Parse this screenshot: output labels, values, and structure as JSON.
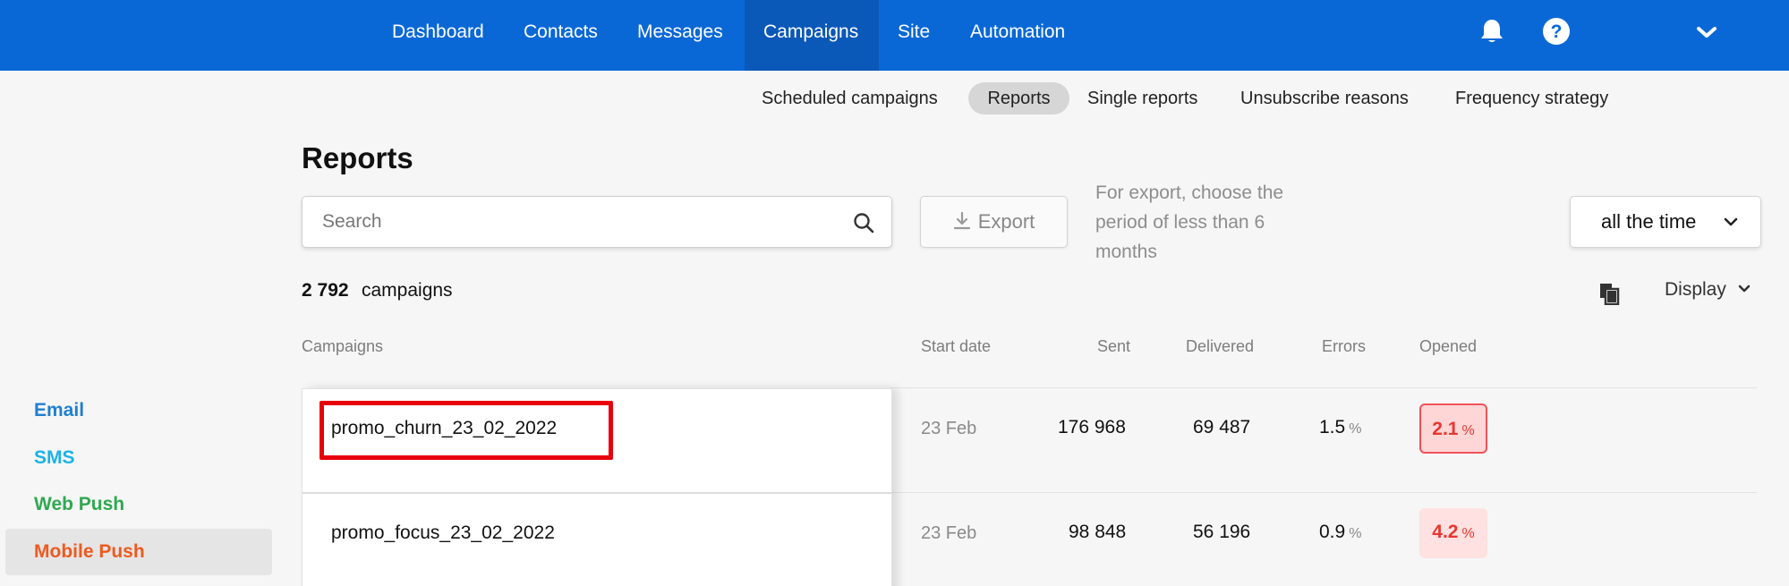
{
  "nav": {
    "items": [
      {
        "label": "Dashboard"
      },
      {
        "label": "Contacts"
      },
      {
        "label": "Messages"
      },
      {
        "label": "Campaigns",
        "active": true
      },
      {
        "label": "Site"
      },
      {
        "label": "Automation"
      }
    ],
    "icons": [
      "bell-icon",
      "help-icon",
      "chevron-down-icon"
    ]
  },
  "subnav": {
    "items": [
      {
        "label": "Scheduled campaigns"
      },
      {
        "label": "Reports",
        "active": true
      },
      {
        "label": "Single reports"
      },
      {
        "label": "Unsubscribe reasons"
      },
      {
        "label": "Frequency strategy"
      }
    ]
  },
  "sidebar": {
    "items": [
      {
        "label": "Email",
        "color": "#1f7fd0"
      },
      {
        "label": "SMS",
        "color": "#1ab3e6"
      },
      {
        "label": "Web Push",
        "color": "#2fa84f"
      },
      {
        "label": "Mobile Push",
        "color": "#ee5a1f",
        "active": true
      }
    ]
  },
  "page": {
    "title": "Reports"
  },
  "toolbar": {
    "search_placeholder": "Search",
    "export_label": "Export",
    "export_hint": "For export, choose the period of less than 6 months",
    "period_value": "all the time"
  },
  "summary": {
    "count": "2 792",
    "count_label": "campaigns",
    "display_label": "Display"
  },
  "table": {
    "columns": {
      "campaigns": "Campaigns",
      "start_date": "Start date",
      "sent": "Sent",
      "delivered": "Delivered",
      "errors": "Errors",
      "opened": "Opened"
    },
    "pct_unit": "%",
    "rows": [
      {
        "name": "promo_churn_23_02_2022",
        "start_date": "23 Feb",
        "sent": "176 968",
        "delivered": "69 487",
        "errors": "1.5",
        "opened": "2.1"
      },
      {
        "name": "promo_focus_23_02_2022",
        "start_date": "23 Feb",
        "sent": "98 848",
        "delivered": "56 196",
        "errors": "0.9",
        "opened": "4.2"
      }
    ]
  },
  "colors": {
    "nav_bg": "#0a68d6",
    "nav_active_bg": "#0a58b8",
    "highlight": "#e8000b",
    "opened_text": "#e8362f"
  }
}
